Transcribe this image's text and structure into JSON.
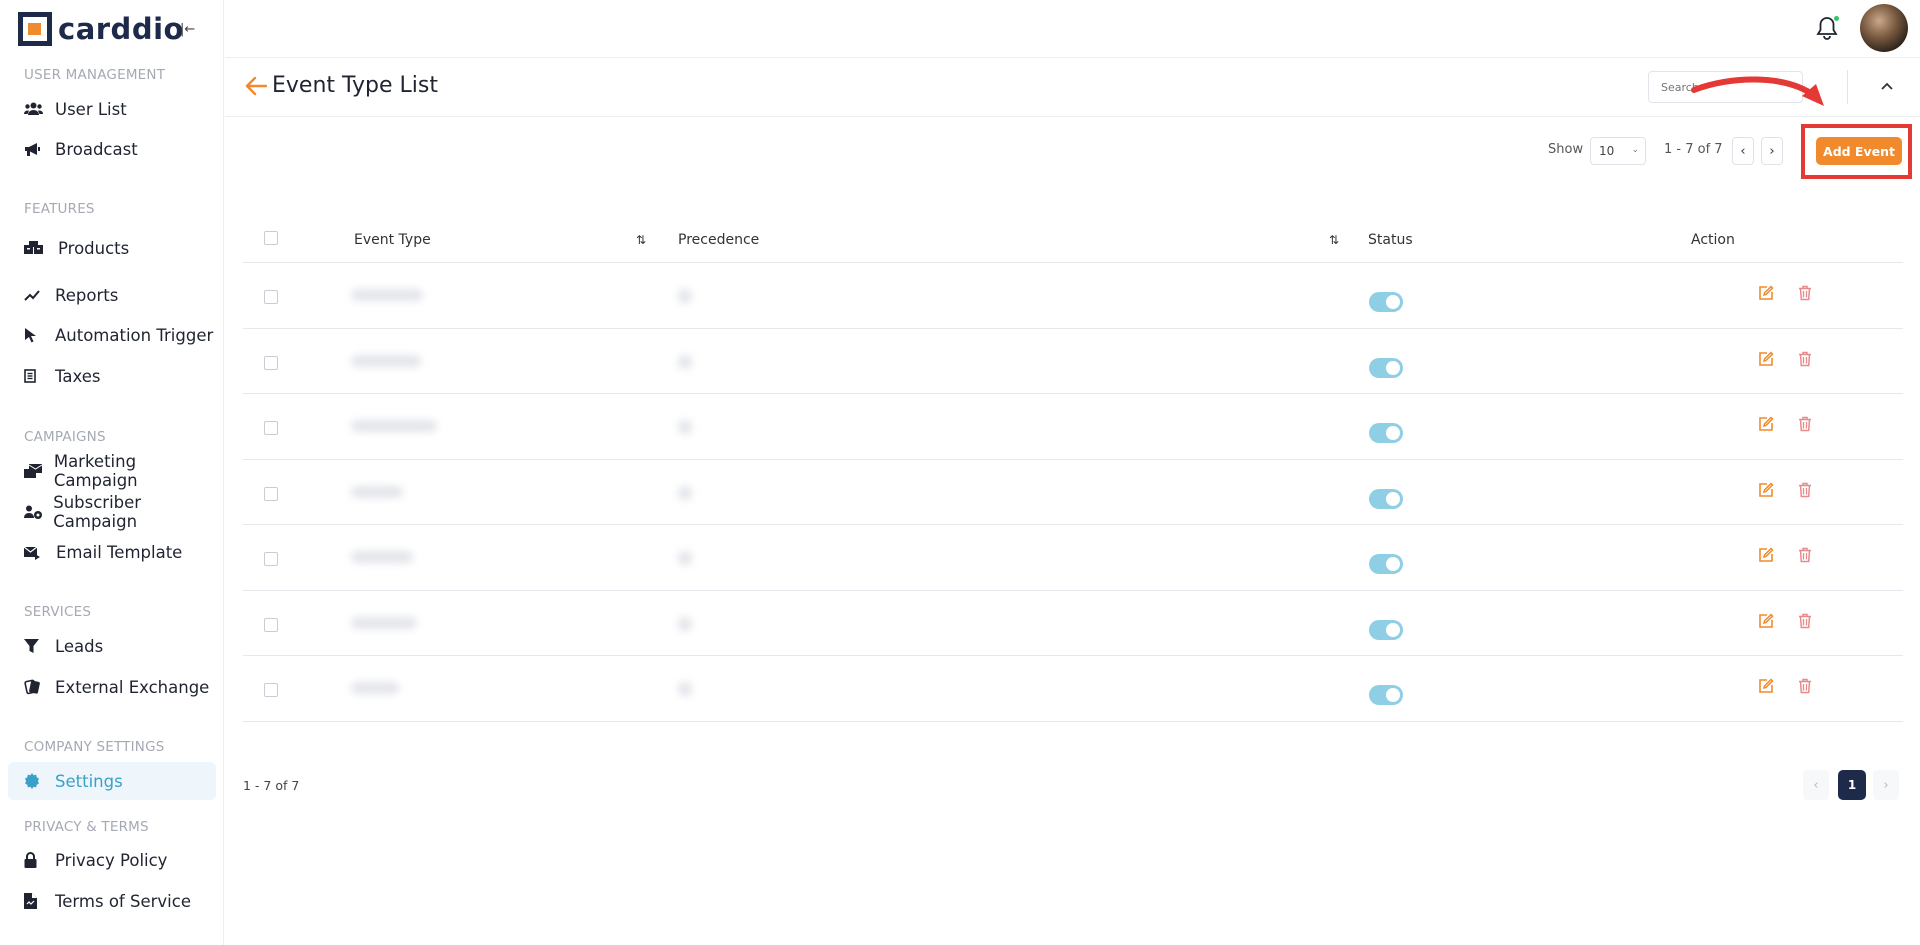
{
  "brand": {
    "name": "carddio",
    "collapse_glyph": "|←"
  },
  "sidebar": {
    "sections": [
      {
        "title": "USER MANAGEMENT"
      },
      {
        "title": "FEATURES"
      },
      {
        "title": "CAMPAIGNS"
      },
      {
        "title": "SERVICES"
      },
      {
        "title": "COMPANY SETTINGS"
      },
      {
        "title": "PRIVACY & TERMS"
      }
    ],
    "items": [
      {
        "label": "User List",
        "icon": "users-icon"
      },
      {
        "label": "Broadcast",
        "icon": "megaphone-icon"
      },
      {
        "label": "Products",
        "icon": "boxes-icon"
      },
      {
        "label": "Reports",
        "icon": "chart-line-icon"
      },
      {
        "label": "Automation Trigger",
        "icon": "cursor-icon"
      },
      {
        "label": "Taxes",
        "icon": "receipt-icon"
      },
      {
        "label": "Marketing Campaign",
        "icon": "mail-bulk-icon"
      },
      {
        "label": "Subscriber Campaign",
        "icon": "users-cog-icon"
      },
      {
        "label": "Email Template",
        "icon": "mail-template-icon"
      },
      {
        "label": "Leads",
        "icon": "funnel-icon"
      },
      {
        "label": "External Exchange",
        "icon": "cards-icon"
      },
      {
        "label": "Settings",
        "icon": "gear-icon",
        "active": true
      },
      {
        "label": "Privacy Policy",
        "icon": "lock-icon"
      },
      {
        "label": "Terms of Service",
        "icon": "document-icon"
      }
    ]
  },
  "header": {
    "title": "Event Type List",
    "search_placeholder": "Search"
  },
  "toolbar": {
    "show_label": "Show",
    "page_size": "10",
    "range": "1 - 7 of 7",
    "prev": "‹",
    "next": "›",
    "add_button": "Add Event"
  },
  "table": {
    "columns": [
      "Event Type",
      "Precedence",
      "Status",
      "Action"
    ],
    "rows": [
      {
        "status": true
      },
      {
        "status": true
      },
      {
        "status": true
      },
      {
        "status": true
      },
      {
        "status": true
      },
      {
        "status": true
      },
      {
        "status": true
      }
    ]
  },
  "footer": {
    "range": "1 - 7 of 7",
    "current_page": "1",
    "prev": "‹",
    "next": "›"
  },
  "colors": {
    "brand_dark": "#1e2a4a",
    "accent_orange": "#f08a2c",
    "active_blue": "#3aa0c8",
    "toggle_on": "#8fcfe6",
    "annotation_red": "#e53935",
    "delete_red": "#e88a8a"
  }
}
